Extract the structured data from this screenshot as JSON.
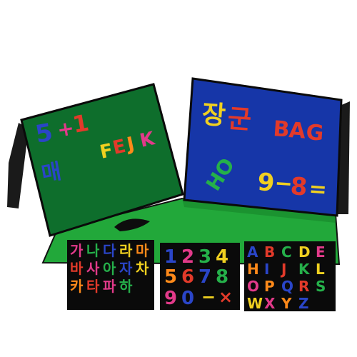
{
  "green_board": {
    "row1": [
      {
        "text": "5",
        "color": "#2a45c8"
      },
      {
        "text": "+",
        "color": "#e23a8a"
      },
      {
        "text": "1",
        "color": "#e23a2a"
      }
    ],
    "row2": [
      {
        "text": "F",
        "color": "#f0d020"
      },
      {
        "text": "E",
        "color": "#e23a2a"
      },
      {
        "text": "J",
        "color": "#ff8a1a"
      },
      {
        "text": "K",
        "color": "#e23a8a"
      }
    ],
    "korean": {
      "text": "매",
      "color": "#2a45c8"
    }
  },
  "blue_board": {
    "korean_top": [
      {
        "text": "장",
        "color": "#f0d020"
      },
      {
        "text": "군",
        "color": "#e23a2a"
      }
    ],
    "word": [
      {
        "text": "B",
        "color": "#e23a2a"
      },
      {
        "text": "A",
        "color": "#e23a2a"
      },
      {
        "text": "G",
        "color": "#e23a2a"
      }
    ],
    "korean_bottom": {
      "text": "HO",
      "color": "#25b04a"
    },
    "equation": [
      {
        "text": "9",
        "color": "#f0d020"
      },
      {
        "text": "−",
        "color": "#f0d020"
      },
      {
        "text": "8",
        "color": "#e23a2a"
      },
      {
        "text": "=",
        "color": "#f0d020"
      }
    ]
  },
  "tiles": {
    "korean": {
      "text": "가나다라마 바사아자 차카타파하",
      "colors": [
        "#e23a8a",
        "#25b04a",
        "#2a45c8",
        "#f0d020",
        "#ff8a1a",
        "#e23a2a"
      ]
    },
    "numbers": {
      "row1": [
        {
          "text": "1",
          "color": "#2a45c8"
        },
        {
          "text": "2",
          "color": "#e23a8a"
        },
        {
          "text": "3",
          "color": "#25b04a"
        },
        {
          "text": "4",
          "color": "#f0d020"
        }
      ],
      "row2": [
        {
          "text": "5",
          "color": "#ff8a1a"
        },
        {
          "text": "6",
          "color": "#e23a2a"
        },
        {
          "text": "7",
          "color": "#2a45c8"
        },
        {
          "text": "8",
          "color": "#25b04a"
        }
      ],
      "row3": [
        {
          "text": "9",
          "color": "#e23a8a"
        },
        {
          "text": "0",
          "color": "#2a45c8"
        },
        {
          "text": "−",
          "color": "#f0d020"
        },
        {
          "text": "×",
          "color": "#e23a2a"
        }
      ]
    },
    "letters": {
      "text": "ABCDE HIJKL OPQRS WXYZ",
      "colors": [
        "#2a45c8",
        "#e23a2a",
        "#25b04a",
        "#f0d020",
        "#e23a8a",
        "#ff8a1a"
      ]
    }
  },
  "colors": {
    "board_green": "#0e6e2c",
    "board_blue": "#1636a8",
    "mat_green": "#22a83a",
    "frame": "#111111"
  }
}
